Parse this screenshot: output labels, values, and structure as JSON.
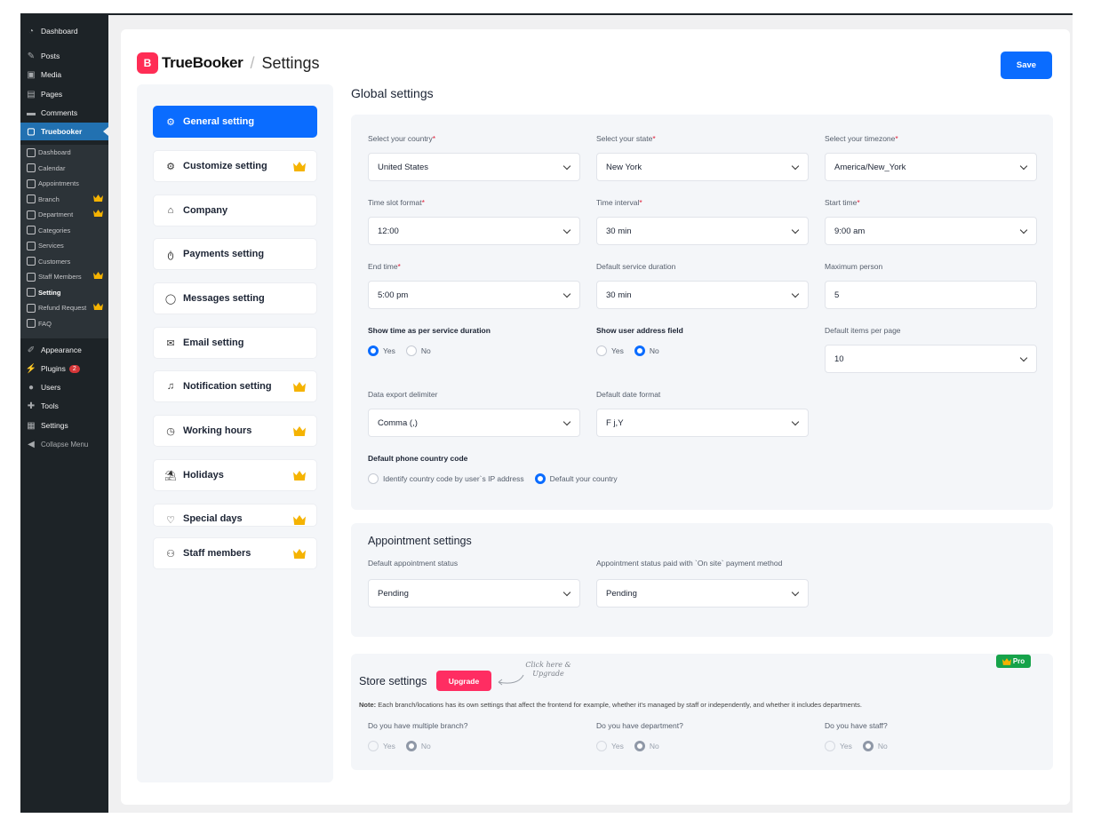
{
  "wp_menu": {
    "items": [
      {
        "label": "Dashboard",
        "icon": "dashboard-icon"
      },
      {
        "label": "Posts",
        "icon": "pin-icon"
      },
      {
        "label": "Media",
        "icon": "media-icon"
      },
      {
        "label": "Pages",
        "icon": "pages-icon"
      },
      {
        "label": "Comments",
        "icon": "comments-icon"
      },
      {
        "label": "Truebooker",
        "icon": "truebooker-icon"
      }
    ],
    "sub_items": [
      {
        "label": "Dashboard"
      },
      {
        "label": "Calendar"
      },
      {
        "label": "Appointments"
      },
      {
        "label": "Branch"
      },
      {
        "label": "Department"
      },
      {
        "label": "Categories"
      },
      {
        "label": "Services"
      },
      {
        "label": "Customers"
      },
      {
        "label": "Staff Members"
      },
      {
        "label": "Setting"
      },
      {
        "label": "Refund Request"
      },
      {
        "label": "FAQ"
      }
    ],
    "lower_items": [
      {
        "label": "Appearance"
      },
      {
        "label": "Plugins",
        "badge": "2"
      },
      {
        "label": "Users"
      },
      {
        "label": "Tools"
      },
      {
        "label": "Settings"
      },
      {
        "label": "Collapse Menu"
      }
    ]
  },
  "header": {
    "brand": "TrueBooker",
    "logo_letter": "B",
    "separator": "/",
    "page_title": "Settings",
    "save_label": "Save"
  },
  "settings_nav": [
    {
      "label": "General setting",
      "active": true
    },
    {
      "label": "Customize setting",
      "pro": true
    },
    {
      "label": "Company"
    },
    {
      "label": "Payments setting"
    },
    {
      "label": "Messages setting"
    },
    {
      "label": "Email setting"
    },
    {
      "label": "Notification setting",
      "pro": true
    },
    {
      "label": "Working hours",
      "pro": true
    },
    {
      "label": "Holidays",
      "pro": true
    },
    {
      "label": "Special days",
      "pro": true
    },
    {
      "label": "Staff members",
      "pro": true
    }
  ],
  "global": {
    "title": "Global settings",
    "country": {
      "label": "Select your country",
      "value": "United States"
    },
    "state": {
      "label": "Select your state",
      "value": "New York"
    },
    "timezone": {
      "label": "Select your timezone",
      "value": "America/New_York"
    },
    "slot_format": {
      "label": "Time slot format",
      "value": "12:00"
    },
    "interval": {
      "label": "Time interval",
      "value": "30 min"
    },
    "start_time": {
      "label": "Start time",
      "value": "9:00 am"
    },
    "end_time": {
      "label": "End time",
      "value": "5:00 pm"
    },
    "service_duration": {
      "label": "Default service duration",
      "value": "30 min"
    },
    "max_person": {
      "label": "Maximum person",
      "value": "5"
    },
    "show_time": {
      "label": "Show time as per service duration",
      "yes": "Yes",
      "no": "No",
      "selected": "yes"
    },
    "show_address": {
      "label": "Show user address field",
      "yes": "Yes",
      "no": "No",
      "selected": "no"
    },
    "items_per_page": {
      "label": "Default items per page",
      "value": "10"
    },
    "export_delimiter": {
      "label": "Data export delimiter",
      "value": "Comma (,)"
    },
    "date_format": {
      "label": "Default date format",
      "value": "F j,Y"
    },
    "phone_code": {
      "label": "Default phone country code",
      "opt1": "Identify country code by user`s IP address",
      "opt2": "Default your country",
      "selected": "opt2"
    }
  },
  "appointment": {
    "title": "Appointment settings",
    "status": {
      "label": "Default appointment status",
      "value": "Pending"
    },
    "onsite_status": {
      "label": "Appointment status paid with `On site` payment method",
      "value": "Pending"
    }
  },
  "store": {
    "title": "Store settings",
    "upgrade_label": "Upgrade",
    "hint": "Click here & Upgrade",
    "pro_label": "Pro",
    "note_prefix": "Note:",
    "note": "Each branch/locations has its own settings that affect the frontend for example, whether it's managed by staff or independently, and whether it includes departments.",
    "branch": {
      "label": "Do you have multiple branch?",
      "yes": "Yes",
      "no": "No"
    },
    "department": {
      "label": "Do you have department?",
      "yes": "Yes",
      "no": "No"
    },
    "staff": {
      "label": "Do you have staff?",
      "yes": "Yes",
      "no": "No"
    }
  },
  "colors": {
    "primary": "#0a6cff",
    "brand": "#ff2d55",
    "pro": "#16a34a",
    "crown": "#f5b301",
    "wp_sidebar": "#1d2327"
  }
}
